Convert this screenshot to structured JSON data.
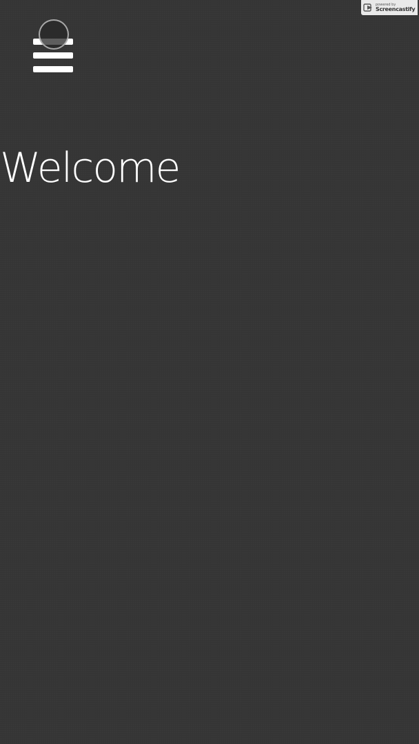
{
  "header": {
    "menu_icon": "hamburger-menu-icon",
    "menu_color": "#ffffff"
  },
  "main": {
    "title": "Welcome"
  },
  "watermark": {
    "powered_by": "powered by",
    "brand": "Screencastify",
    "icon": "screencastify-logo-icon"
  },
  "theme": {
    "background": "#363636",
    "text": "#ffffff"
  }
}
